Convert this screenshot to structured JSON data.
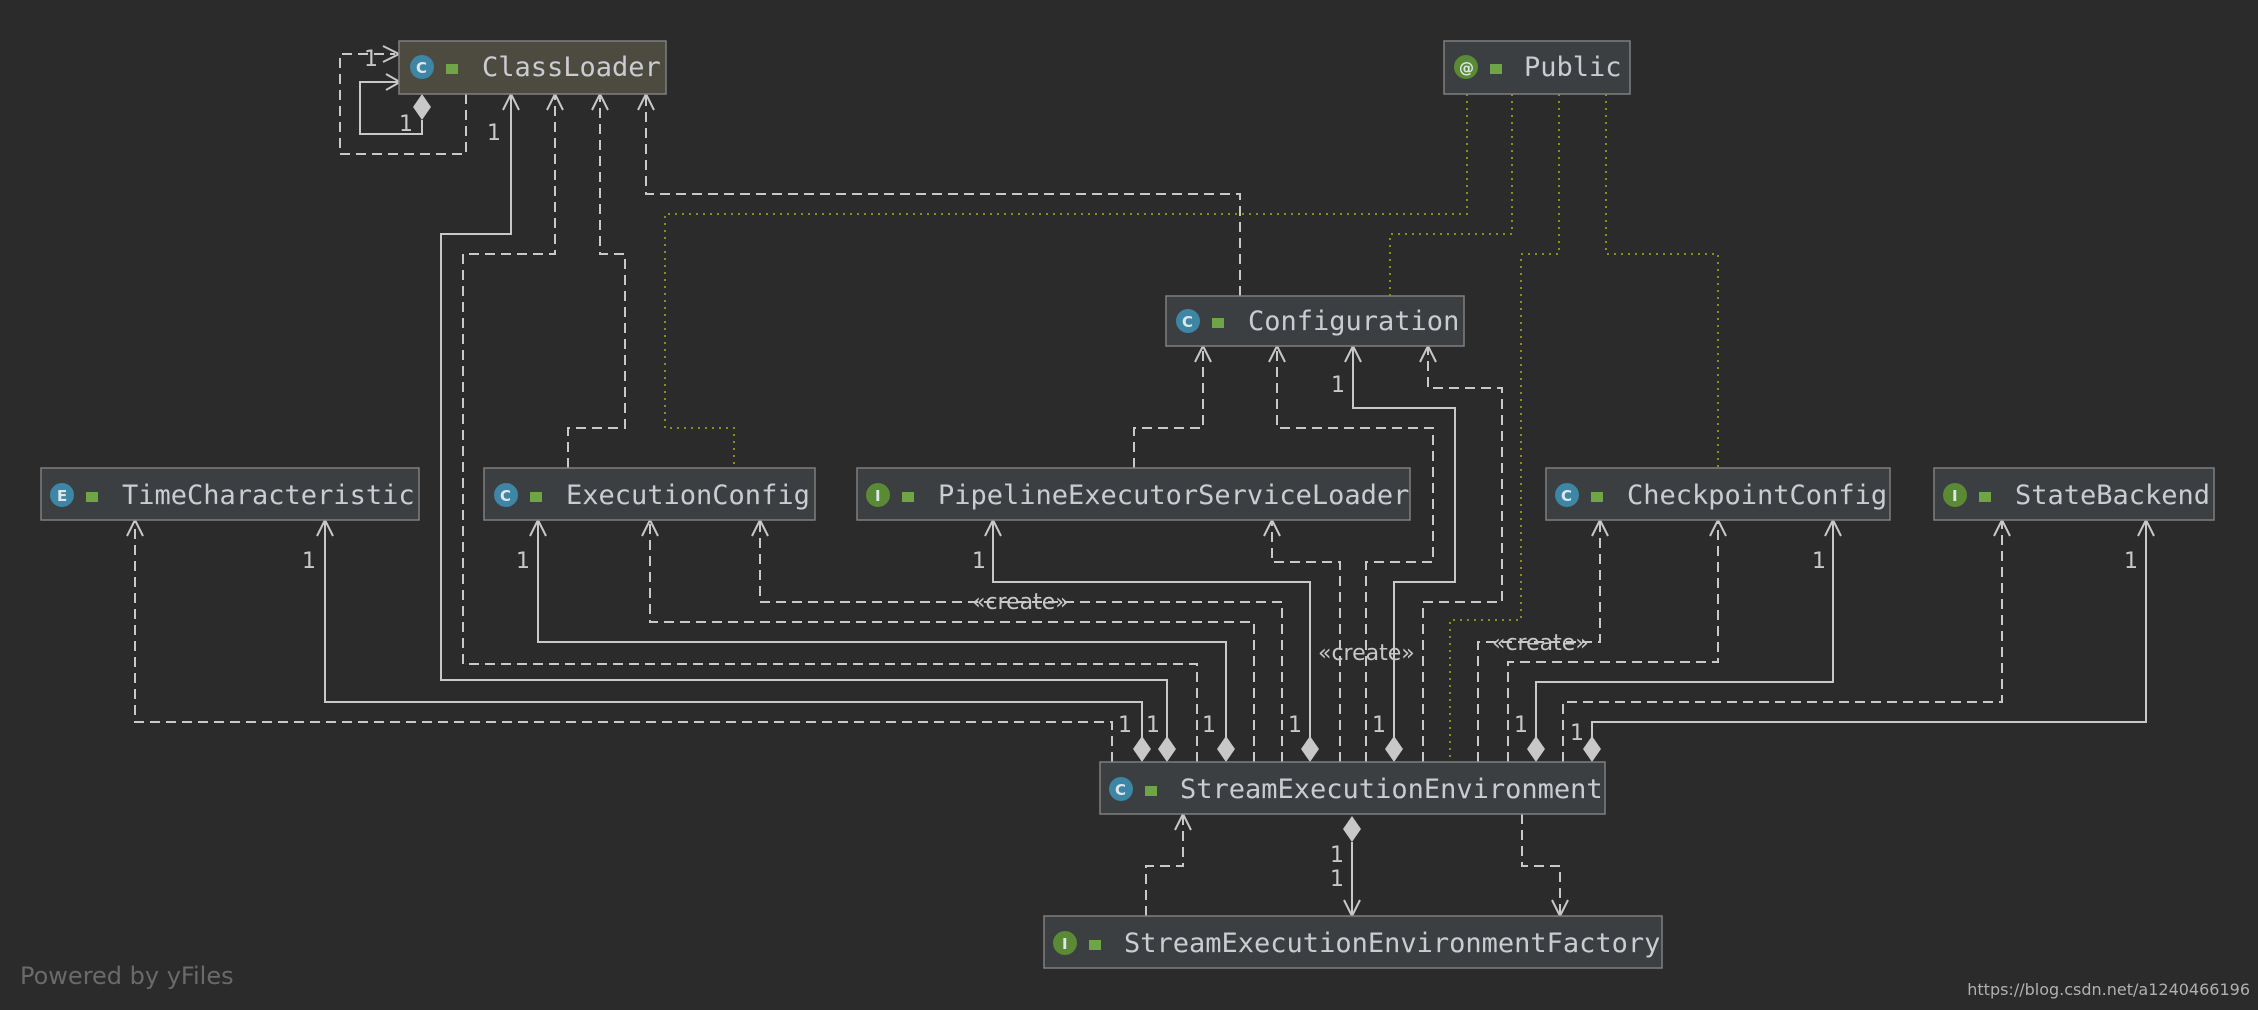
{
  "nodes": {
    "classloader": {
      "name": "ClassLoader",
      "kind": "C"
    },
    "public": {
      "name": "Public",
      "kind": "@"
    },
    "configuration": {
      "name": "Configuration",
      "kind": "C"
    },
    "timechar": {
      "name": "TimeCharacteristic",
      "kind": "E"
    },
    "execconfig": {
      "name": "ExecutionConfig",
      "kind": "C"
    },
    "pipeline": {
      "name": "PipelineExecutorServiceLoader",
      "kind": "I"
    },
    "checkpoint": {
      "name": "CheckpointConfig",
      "kind": "C"
    },
    "statebackend": {
      "name": "StateBackend",
      "kind": "I"
    },
    "see": {
      "name": "StreamExecutionEnvironment",
      "kind": "C"
    },
    "seefactory": {
      "name": "StreamExecutionEnvironmentFactory",
      "kind": "I"
    }
  },
  "labels": {
    "create": "«create»",
    "one": "1"
  },
  "footer": {
    "powered": "Powered by yFiles",
    "url": "https://blog.csdn.net/a1240466196"
  },
  "colors": {
    "background": "#2b2b2b",
    "class_badge": "#3d86a6",
    "interface_badge": "#5a8a34",
    "dotted_edge": "#8a8f1a"
  }
}
